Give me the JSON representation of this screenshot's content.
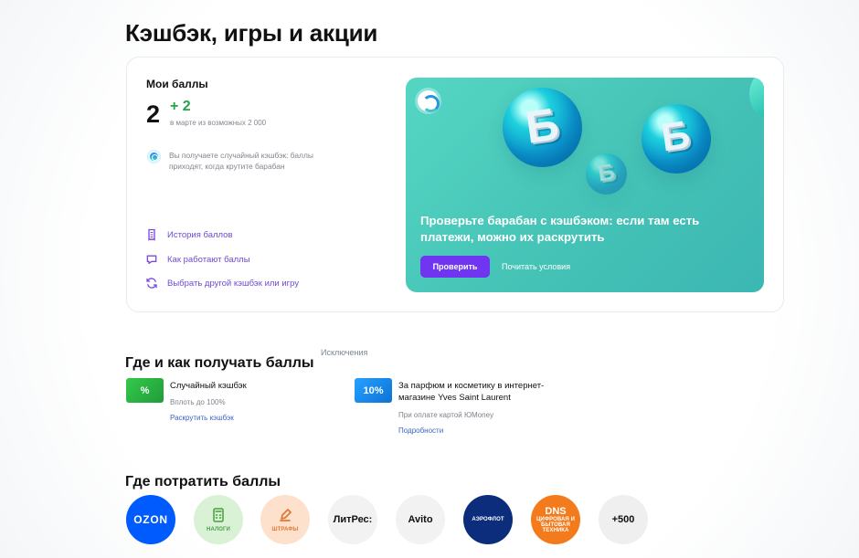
{
  "page": {
    "title": "Кэшбэк, игры и акции"
  },
  "points": {
    "title": "Мои баллы",
    "value": "2",
    "gain": "+ 2",
    "caption": "в марте из возможных 2 000",
    "info": "Вы получаете случайный кэшбэк: баллы приходят, когда крутите барабан",
    "links": [
      {
        "label": "История баллов",
        "icon": "receipt-icon"
      },
      {
        "label": "Как работают баллы",
        "icon": "chat-icon"
      },
      {
        "label": "Выбрать другой кэшбэк или игру",
        "icon": "refresh-icon"
      }
    ]
  },
  "promo": {
    "headline": "Проверьте барабан с кэшбэком: если там есть платежи, можно их раскрутить",
    "button": "Проверить",
    "terms": "Почитать условия",
    "coin_symbol": "Б",
    "colors": {
      "background": "#45c3b6",
      "button": "#6f35f0"
    }
  },
  "earn": {
    "title": "Где и как получать баллы",
    "note": "Исключения",
    "items": [
      {
        "badge": "%",
        "title": "Случайный кэшбэк",
        "subtitle": "Вплоть до 100%",
        "link": "Раскрутить кэшбэк",
        "color": "#36b84a"
      },
      {
        "badge": "10%",
        "title": "За парфюм и косметику в интернет-магазине Yves Saint Laurent",
        "subtitle": "При оплате картой ЮMoney",
        "link": "Подробности",
        "color": "#168eea"
      }
    ]
  },
  "spend": {
    "title": "Где потратить баллы",
    "partners": [
      {
        "label": "OZON"
      },
      {
        "label": "НАЛОГИ",
        "icon": "calculator-icon"
      },
      {
        "label": "ШТРАФЫ",
        "icon": "pencil-icon"
      },
      {
        "label": "ЛитРес:"
      },
      {
        "label": "Avito"
      },
      {
        "label": "АЭРОФЛОТ"
      },
      {
        "label": "DNS",
        "subtitle": "ЦИФРОВАЯ И БЫТОВАЯ ТЕХНИКА"
      },
      {
        "label": "+500"
      }
    ]
  }
}
